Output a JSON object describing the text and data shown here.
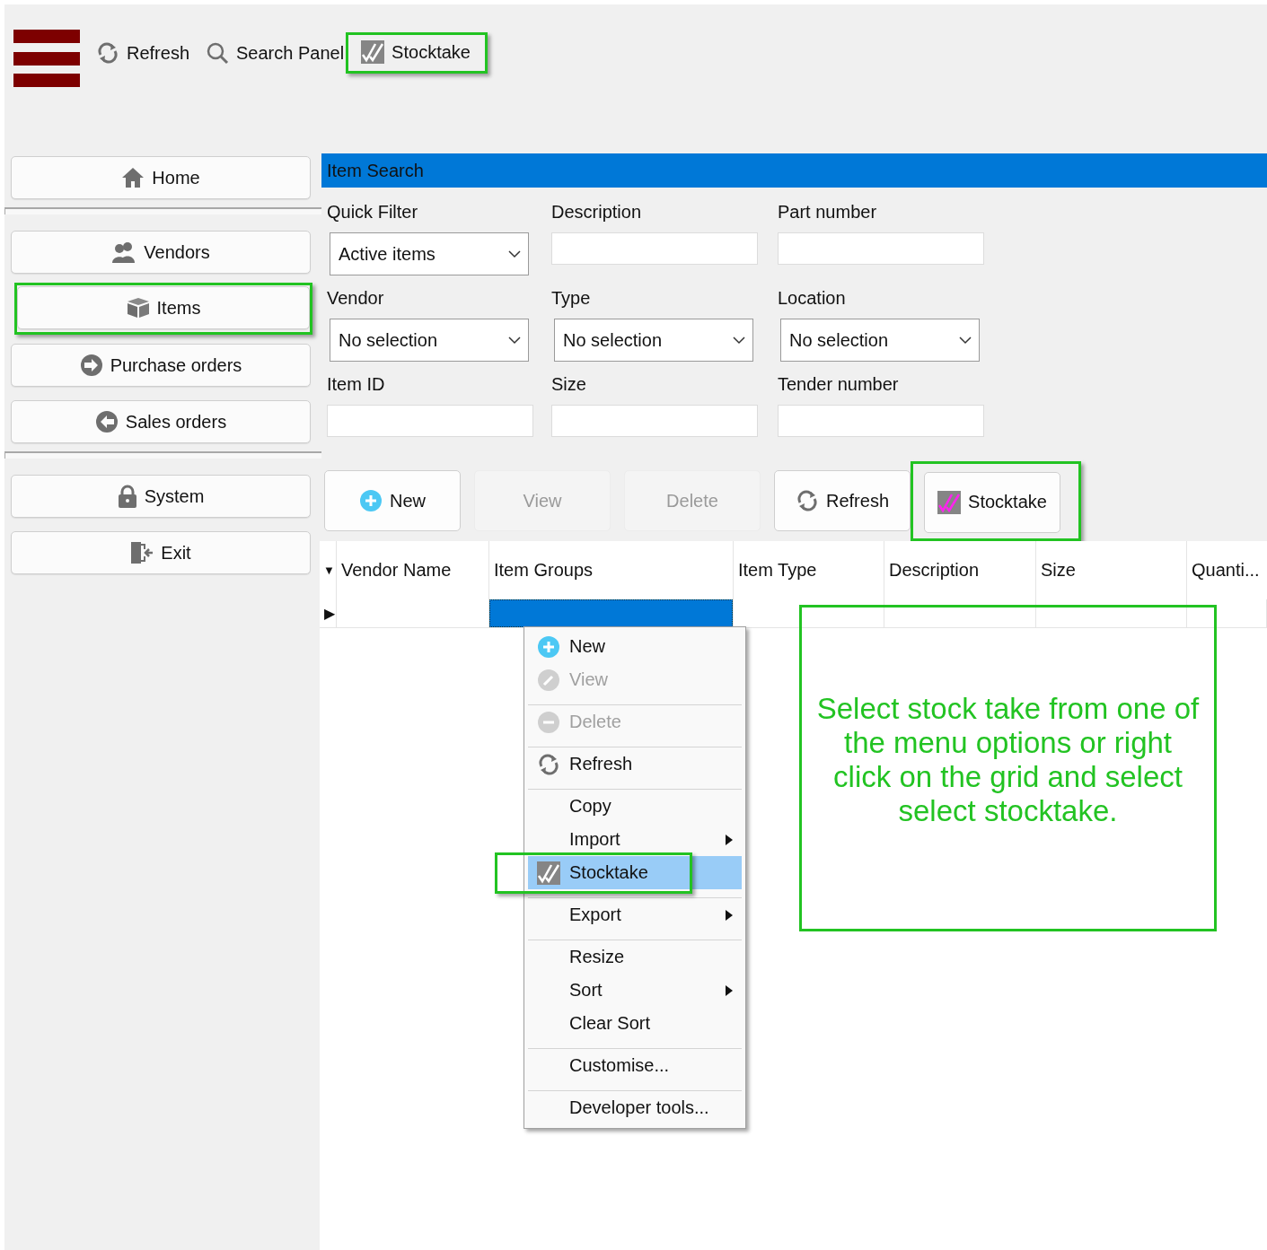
{
  "toolbar": {
    "items": [
      {
        "kind": "refresh",
        "label": "Refresh",
        "highlighted": false
      },
      {
        "kind": "search",
        "label": "Search Panel",
        "highlighted": false
      },
      {
        "kind": "stocktake",
        "label": "Stocktake",
        "highlighted": true
      }
    ]
  },
  "sidebar": {
    "groups": [
      [
        {
          "kind": "home",
          "label": "Home",
          "highlighted": false
        }
      ],
      [
        {
          "kind": "vendors",
          "label": "Vendors",
          "highlighted": false
        },
        {
          "kind": "box",
          "label": "Items",
          "highlighted": true
        },
        {
          "kind": "arrow-in",
          "label": "Purchase orders",
          "highlighted": false
        },
        {
          "kind": "arrow-out",
          "label": "Sales orders",
          "highlighted": false
        }
      ],
      [
        {
          "kind": "lock",
          "label": "System",
          "highlighted": false
        },
        {
          "kind": "exit",
          "label": "Exit",
          "highlighted": false
        }
      ]
    ]
  },
  "search_panel": {
    "title": "Item Search",
    "fields": [
      {
        "label": "Quick Filter",
        "kind": "select",
        "value": "Active items"
      },
      {
        "label": "Description",
        "kind": "text"
      },
      {
        "label": "Part number",
        "kind": "text"
      },
      {
        "label": "Vendor",
        "kind": "select",
        "value": "No selection"
      },
      {
        "label": "Type",
        "kind": "select",
        "value": "No selection"
      },
      {
        "label": "Location",
        "kind": "select",
        "value": "No selection"
      },
      {
        "label": "Item ID",
        "kind": "text"
      },
      {
        "label": "Size",
        "kind": "text"
      },
      {
        "label": "Tender number",
        "kind": "text"
      }
    ]
  },
  "actions": [
    {
      "kind": "plus",
      "label": "New",
      "disabled": false,
      "highlighted": false
    },
    {
      "kind": "none",
      "label": "View",
      "disabled": true,
      "highlighted": false
    },
    {
      "kind": "none",
      "label": "Delete",
      "disabled": true,
      "highlighted": false
    },
    {
      "kind": "refresh",
      "label": "Refresh",
      "disabled": false,
      "highlighted": false
    },
    {
      "kind": "stocktake-magenta",
      "label": "Stocktake",
      "disabled": false,
      "highlighted": true
    }
  ],
  "grid": {
    "sort_marker": "▼",
    "row_marker": "▶",
    "columns": [
      {
        "label": "Vendor Name",
        "selected": false
      },
      {
        "label": "Item Groups",
        "selected": true
      },
      {
        "label": "Item Type",
        "selected": false
      },
      {
        "label": "Description",
        "selected": false
      },
      {
        "label": "Size",
        "selected": false
      },
      {
        "label": "Quanti...",
        "selected": false
      }
    ]
  },
  "context_menu": {
    "items": [
      {
        "label": "New",
        "kind": "plus",
        "disabled": false,
        "selected": false,
        "submenu": false,
        "separator_after": false,
        "highlighted": false
      },
      {
        "label": "View",
        "kind": "pencil",
        "disabled": true,
        "selected": false,
        "submenu": false,
        "separator_after": true,
        "highlighted": false
      },
      {
        "label": "Delete",
        "kind": "minus",
        "disabled": true,
        "selected": false,
        "submenu": false,
        "separator_after": true,
        "highlighted": false
      },
      {
        "label": "Refresh",
        "kind": "refresh",
        "disabled": false,
        "selected": false,
        "submenu": false,
        "separator_after": true,
        "highlighted": false
      },
      {
        "label": "Copy",
        "kind": "none",
        "disabled": false,
        "selected": false,
        "submenu": false,
        "separator_after": false,
        "highlighted": false
      },
      {
        "label": "Import",
        "kind": "none",
        "disabled": false,
        "selected": false,
        "submenu": true,
        "separator_after": false,
        "highlighted": false
      },
      {
        "label": "Stocktake",
        "kind": "stocktake",
        "disabled": false,
        "selected": true,
        "submenu": false,
        "separator_after": true,
        "highlighted": true
      },
      {
        "label": "Export",
        "kind": "none",
        "disabled": false,
        "selected": false,
        "submenu": true,
        "separator_after": true,
        "highlighted": false
      },
      {
        "label": "Resize",
        "kind": "none",
        "disabled": false,
        "selected": false,
        "submenu": false,
        "separator_after": false,
        "highlighted": false
      },
      {
        "label": "Sort",
        "kind": "none",
        "disabled": false,
        "selected": false,
        "submenu": true,
        "separator_after": false,
        "highlighted": false
      },
      {
        "label": "Clear Sort",
        "kind": "none",
        "disabled": false,
        "selected": false,
        "submenu": false,
        "separator_after": true,
        "highlighted": false
      },
      {
        "label": "Customise...",
        "kind": "none",
        "disabled": false,
        "selected": false,
        "submenu": false,
        "separator_after": true,
        "highlighted": false
      },
      {
        "label": "Developer tools...",
        "kind": "none",
        "disabled": false,
        "selected": false,
        "submenu": false,
        "separator_after": false,
        "highlighted": false
      }
    ]
  },
  "callout": {
    "text": "Select stock take from one of the menu options or right click on the grid and select select stocktake."
  }
}
